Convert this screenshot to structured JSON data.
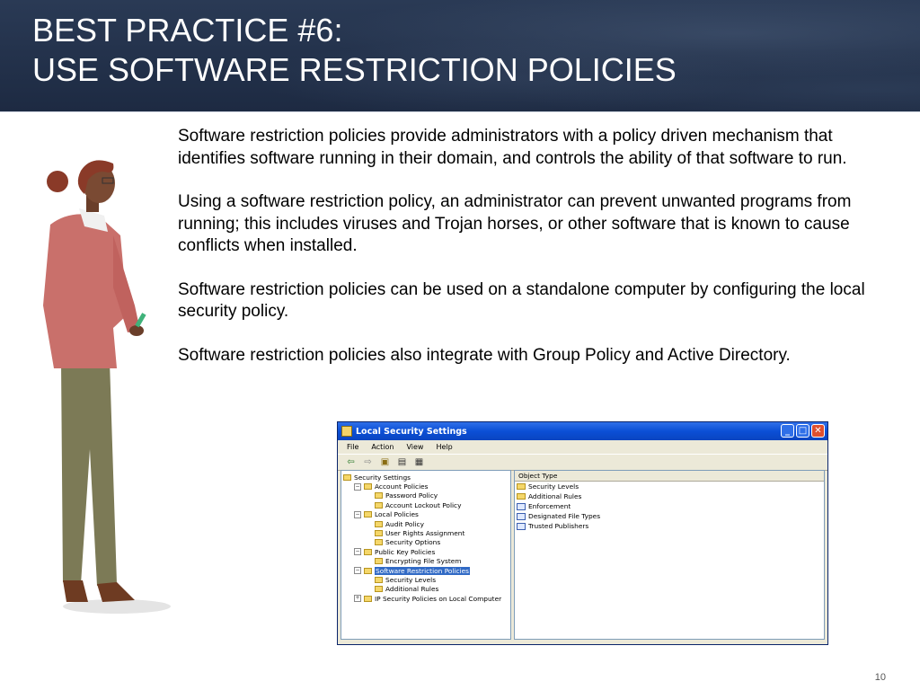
{
  "slide": {
    "title_line1": "BEST PRACTICE #6:",
    "title_line2": "USE SOFTWARE RESTRICTION POLICIES",
    "paragraphs": [
      "Software restriction policies provide administrators with a policy driven mechanism that identifies software running in their domain, and controls the ability of that software to run.",
      "Using a software restriction policy, an administrator can prevent unwanted programs from running; this includes viruses and Trojan horses, or other software that is known to cause conflicts when installed.",
      "Software restriction policies can be used on a standalone computer by configuring the local security policy.",
      "Software restriction policies also integrate with Group Policy and Active Directory."
    ],
    "page_number": "10"
  },
  "window": {
    "title": "Local Security Settings",
    "menu": [
      "File",
      "Action",
      "View",
      "Help"
    ],
    "tree": [
      {
        "label": "Security Settings",
        "level": 0,
        "sign": ""
      },
      {
        "label": "Account Policies",
        "level": 1,
        "sign": "−"
      },
      {
        "label": "Password Policy",
        "level": 2,
        "sign": ""
      },
      {
        "label": "Account Lockout Policy",
        "level": 2,
        "sign": ""
      },
      {
        "label": "Local Policies",
        "level": 1,
        "sign": "−"
      },
      {
        "label": "Audit Policy",
        "level": 2,
        "sign": ""
      },
      {
        "label": "User Rights Assignment",
        "level": 2,
        "sign": ""
      },
      {
        "label": "Security Options",
        "level": 2,
        "sign": ""
      },
      {
        "label": "Public Key Policies",
        "level": 1,
        "sign": "−"
      },
      {
        "label": "Encrypting File System",
        "level": 2,
        "sign": ""
      },
      {
        "label": "Software Restriction Policies",
        "level": 1,
        "sign": "−",
        "selected": true
      },
      {
        "label": "Security Levels",
        "level": 2,
        "sign": ""
      },
      {
        "label": "Additional Rules",
        "level": 2,
        "sign": ""
      },
      {
        "label": "IP Security Policies on Local Computer",
        "level": 1,
        "sign": "+"
      }
    ],
    "list_header": "Object Type",
    "list_items": [
      {
        "label": "Security Levels",
        "icon": "folder"
      },
      {
        "label": "Additional Rules",
        "icon": "folder"
      },
      {
        "label": "Enforcement",
        "icon": "doc"
      },
      {
        "label": "Designated File Types",
        "icon": "doc"
      },
      {
        "label": "Trusted Publishers",
        "icon": "doc"
      }
    ]
  }
}
